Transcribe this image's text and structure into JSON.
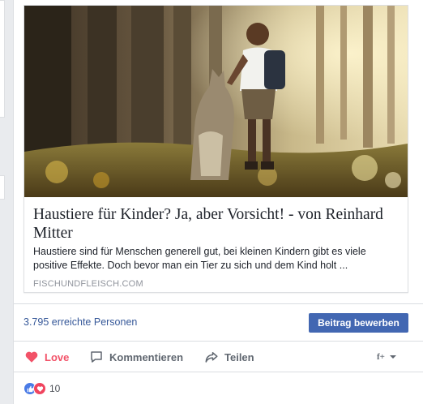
{
  "link_preview": {
    "title": "Haustiere für Kinder? Ja, aber Vorsicht! - von Reinhard Mitter",
    "description": "Haustiere sind für Menschen generell gut, bei kleinen Kindern gibt es viele positive Effekte. Doch bevor man ein Tier zu sich und dem Kind holt ...",
    "domain": "FISCHUNDFLEISCH.COM",
    "image": "boy-with-dog-in-forest"
  },
  "stats": {
    "reach": "3.795 erreichte Personen",
    "boost_label": "Beitrag bewerben"
  },
  "actions": {
    "love": "Love",
    "comment": "Kommentieren",
    "share": "Teilen",
    "page_selector": "f+"
  },
  "reactions": {
    "count": "10",
    "types": [
      "like",
      "love"
    ]
  },
  "colors": {
    "link": "#365899",
    "button": "#4267b2",
    "love": "#f25268",
    "muted": "#90949c"
  },
  "icons": [
    "heart-icon",
    "comment-icon",
    "share-arrow-icon",
    "chevron-down-icon",
    "like-reaction-icon",
    "love-reaction-icon"
  ]
}
